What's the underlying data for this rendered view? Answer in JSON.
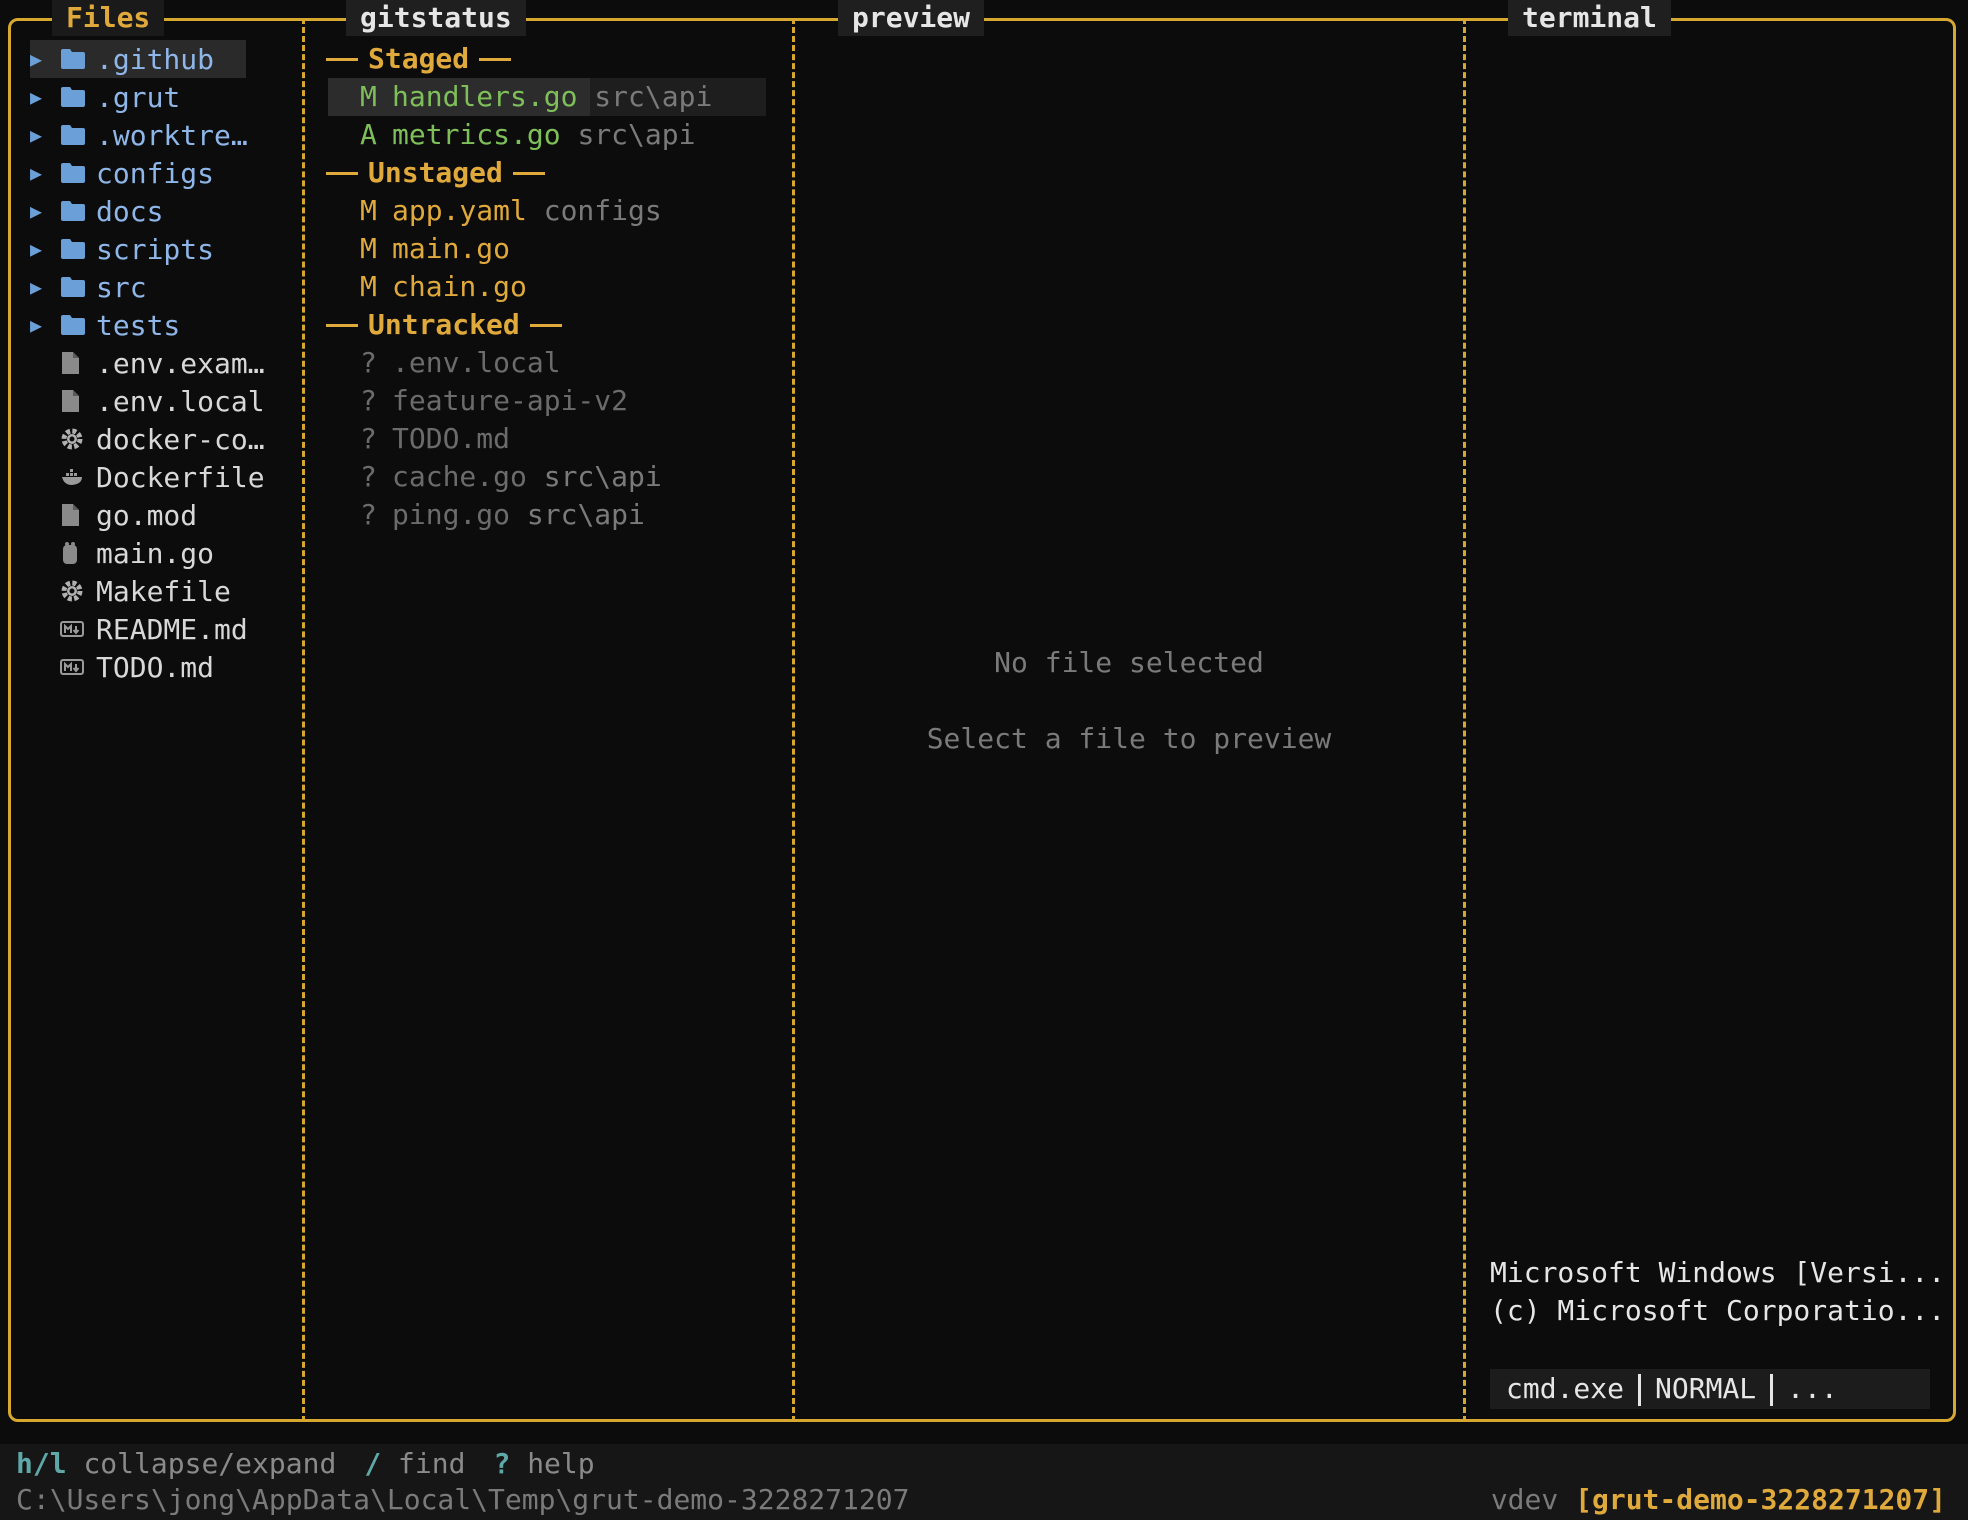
{
  "panes": {
    "files_title": "Files",
    "git_title": "gitstatus",
    "preview_title": "preview",
    "terminal_title": "terminal"
  },
  "files": [
    {
      "name": ".github",
      "kind": "dir",
      "icon": "folder-icon",
      "selected": true
    },
    {
      "name": ".grut",
      "kind": "dir",
      "icon": "folder-icon"
    },
    {
      "name": ".worktre…",
      "kind": "dir",
      "icon": "folder-icon"
    },
    {
      "name": "configs",
      "kind": "dir",
      "icon": "folder-icon"
    },
    {
      "name": "docs",
      "kind": "dir",
      "icon": "folder-icon"
    },
    {
      "name": "scripts",
      "kind": "dir",
      "icon": "folder-icon"
    },
    {
      "name": "src",
      "kind": "dir",
      "icon": "folder-icon"
    },
    {
      "name": "tests",
      "kind": "dir",
      "icon": "folder-icon"
    },
    {
      "name": ".env.exam…",
      "kind": "file",
      "icon": "file-icon"
    },
    {
      "name": ".env.local",
      "kind": "file",
      "icon": "file-icon"
    },
    {
      "name": "docker-co…",
      "kind": "file",
      "icon": "gear-icon"
    },
    {
      "name": "Dockerfile",
      "kind": "file",
      "icon": "docker-icon"
    },
    {
      "name": "go.mod",
      "kind": "file",
      "icon": "file-icon"
    },
    {
      "name": "main.go",
      "kind": "file",
      "icon": "go-file-icon"
    },
    {
      "name": "Makefile",
      "kind": "file",
      "icon": "gear-icon"
    },
    {
      "name": "README.md",
      "kind": "file",
      "icon": "markdown-icon"
    },
    {
      "name": "TODO.md",
      "kind": "file",
      "icon": "markdown-icon"
    }
  ],
  "git": {
    "staged_label": "Staged",
    "unstaged_label": "Unstaged",
    "untracked_label": "Untracked",
    "staged": [
      {
        "status": "M",
        "name": "handlers.go",
        "path": "src\\api"
      },
      {
        "status": "A",
        "name": "metrics.go",
        "path": "src\\api"
      }
    ],
    "unstaged": [
      {
        "status": "M",
        "name": "app.yaml",
        "path": "configs"
      },
      {
        "status": "M",
        "name": "main.go",
        "path": ""
      },
      {
        "status": "M",
        "name": "chain.go",
        "path": ""
      }
    ],
    "untracked": [
      {
        "status": "?",
        "name": ".env.local",
        "path": ""
      },
      {
        "status": "?",
        "name": "feature-api-v2",
        "path": ""
      },
      {
        "status": "?",
        "name": "TODO.md",
        "path": ""
      },
      {
        "status": "?",
        "name": "cache.go",
        "path": "src\\api"
      },
      {
        "status": "?",
        "name": "ping.go",
        "path": "src\\api"
      }
    ]
  },
  "preview": {
    "line1": "No file selected",
    "line2": "Select a file to preview"
  },
  "terminal": {
    "line1": "Microsoft Windows [Versi...",
    "line2": "(c) Microsoft Corporatio...",
    "status_shell": "cmd.exe",
    "status_mode": "NORMAL",
    "status_more": "..."
  },
  "hints": [
    {
      "key": "h/l",
      "desc": "collapse/expand"
    },
    {
      "key": "/",
      "desc": "find"
    },
    {
      "key": "?",
      "desc": "help"
    }
  ],
  "footer": {
    "path": "C:\\Users\\jong\\AppData\\Local\\Temp\\grut-demo-3228271207",
    "version": "vdev",
    "branch": "[grut-demo-3228271207]"
  },
  "colors": {
    "accent": "#d7a82f",
    "staged": "#7fbf5a",
    "folder": "#6a9fd8",
    "background": "#0c0c0c"
  }
}
